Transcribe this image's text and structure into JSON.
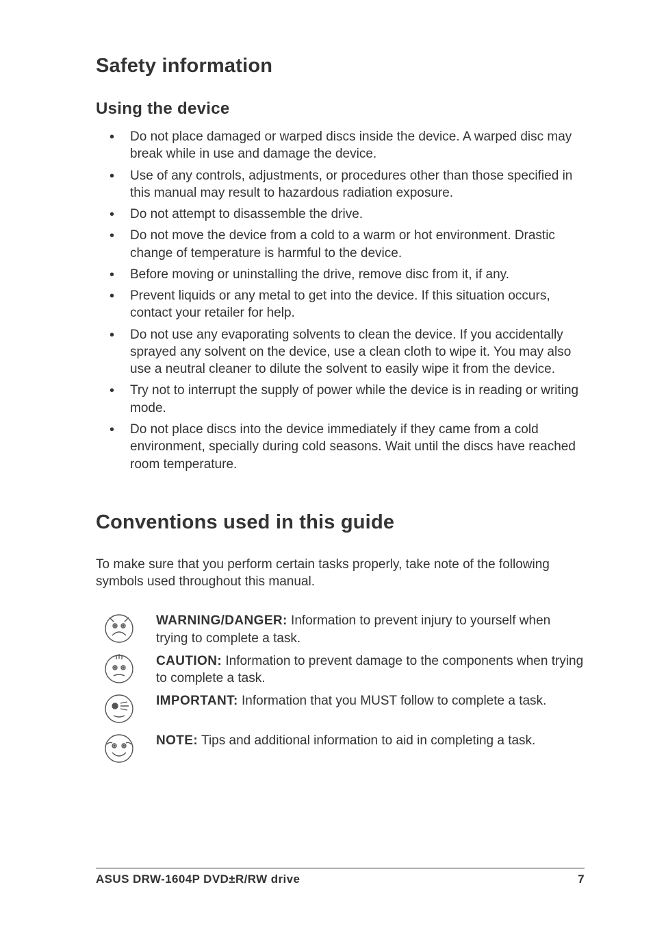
{
  "section1": {
    "title": "Safety information",
    "subhead": "Using the device",
    "bullets": [
      "Do not place damaged or warped discs inside the device. A warped disc may break while in use and damage the device.",
      "Use  of any controls, adjustments, or procedures other than those specified in this manual may result to hazardous radiation exposure.",
      "Do not attempt to disassemble the drive.",
      "Do not move the device from a cold to a warm or hot environment. Drastic change of temperature is harmful to the device.",
      "Before moving or uninstalling the drive, remove disc from it, if any.",
      "Prevent liquids or any metal to get into the device. If this situation occurs, contact your retailer for help.",
      "Do not use any evaporating solvents to clean the device. If you accidentally sprayed any solvent on the device, use a clean cloth to wipe it. You may also use a neutral cleaner to dilute the solvent to easily wipe it from the device.",
      "Try not to interrupt the supply of power while the device is in reading or writing mode.",
      "Do not place discs into the device immediately if they came from a cold environment, specially during cold seasons. Wait until the discs have reached room temperature."
    ]
  },
  "section2": {
    "title": "Conventions used in this guide",
    "intro": "To make sure that you perform certain tasks properly, take note of the following symbols used throughout this manual.",
    "items": [
      {
        "label": "WARNING/DANGER:",
        "text": " Information to prevent injury to yourself when trying to complete a task."
      },
      {
        "label": "CAUTION:",
        "text": " Information to prevent damage to the components when trying to complete a task."
      },
      {
        "label": "IMPORTANT:",
        "text": " Information that you MUST follow to complete a task."
      },
      {
        "label": "NOTE:",
        "text": "  Tips and additional information to aid in completing a task."
      }
    ]
  },
  "footer": {
    "left": "ASUS DRW-1604P DVD±R/RW drive",
    "right": "7"
  }
}
